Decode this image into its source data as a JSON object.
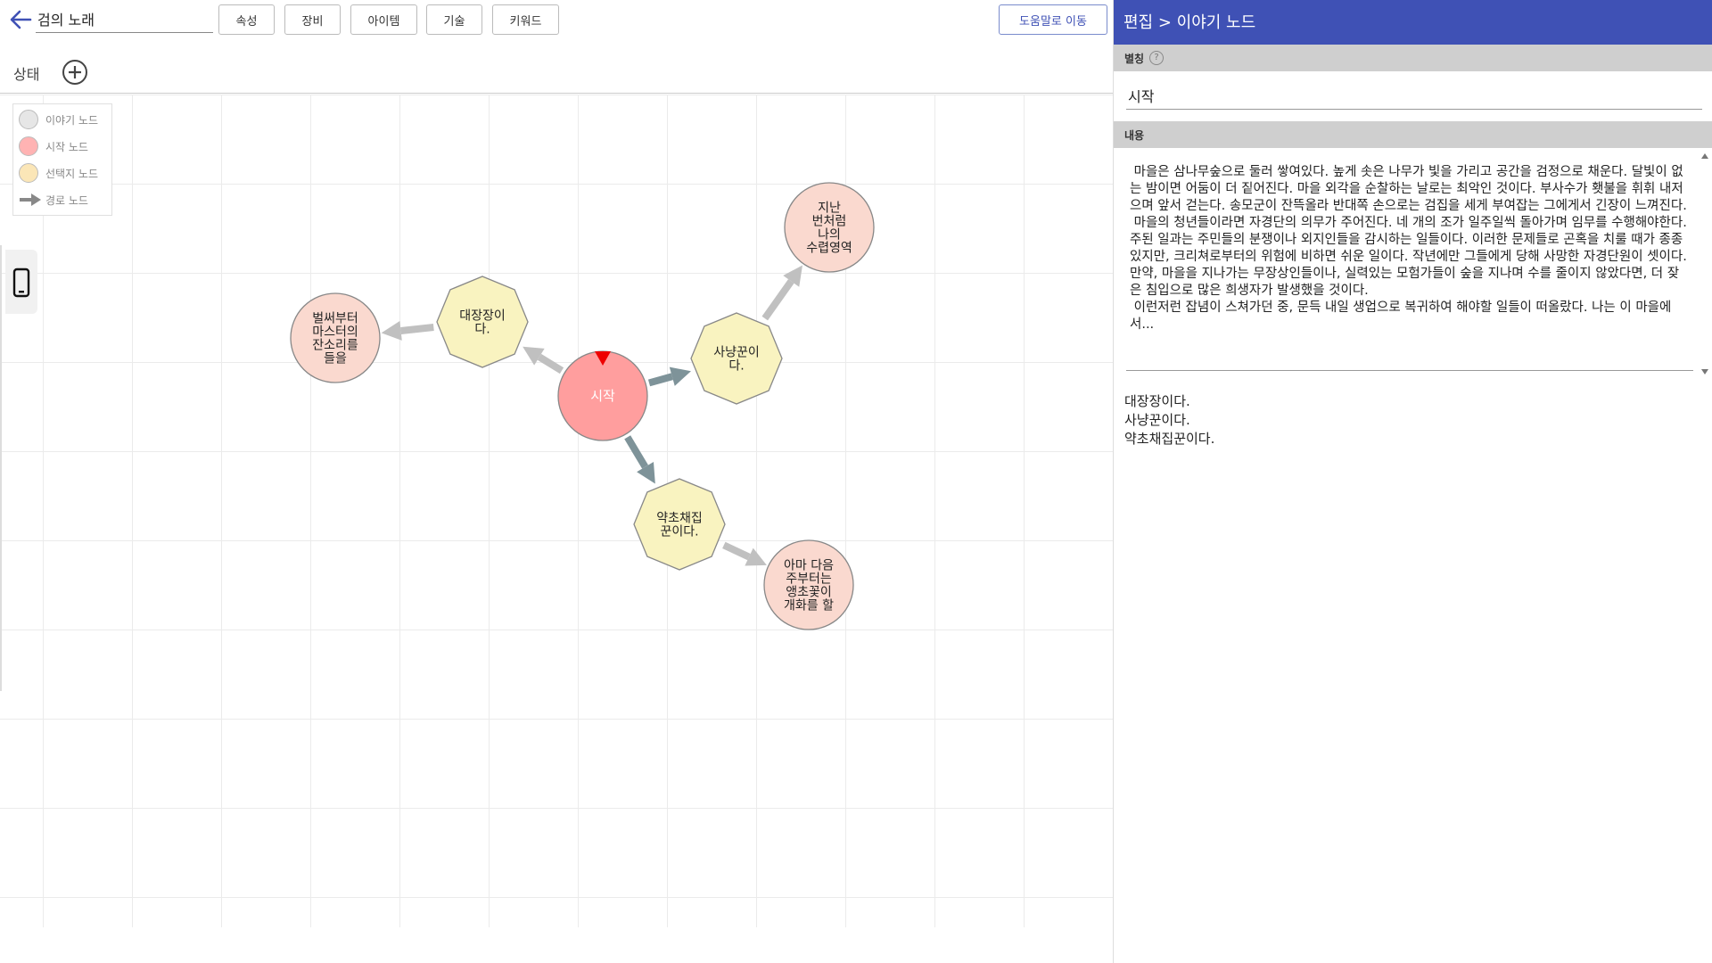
{
  "toolbar": {
    "title_value": "검의 노래",
    "buttons": [
      "속성",
      "장비",
      "아이템",
      "기술",
      "키워드"
    ],
    "help_label": "도움말로 이동"
  },
  "state": {
    "label": "상태"
  },
  "legend": {
    "items": [
      {
        "label": "이야기 노드",
        "color": "#e6e6e6"
      },
      {
        "label": "시작 노드",
        "color": "#ffb3b3"
      },
      {
        "label": "선택지 노드",
        "color": "#fbe6b7"
      },
      {
        "label": "경로 노드",
        "color": "#888888"
      }
    ]
  },
  "graph": {
    "nodes": [
      {
        "id": "start",
        "type": "start",
        "label": "시작"
      },
      {
        "id": "c1",
        "type": "choice",
        "label": "대장장이\n다."
      },
      {
        "id": "c2",
        "type": "choice",
        "label": "사냥꾼이\n다."
      },
      {
        "id": "c3",
        "type": "choice",
        "label": "약초채집\n꾼이다."
      },
      {
        "id": "s1",
        "type": "story",
        "label": "벌써부터\n마스터의\n잔소리를\n들을"
      },
      {
        "id": "s2",
        "type": "story",
        "label": "지난\n번처럼\n나의\n수렵영역"
      },
      {
        "id": "s3",
        "type": "story",
        "label": "아마 다음\n주부터는\n앵초꽃이\n개화를 할"
      }
    ],
    "edges": [
      {
        "from": "start",
        "to": "c1",
        "kind": "light"
      },
      {
        "from": "start",
        "to": "c2",
        "kind": "dark"
      },
      {
        "from": "start",
        "to": "c3",
        "kind": "dark"
      },
      {
        "from": "c1",
        "to": "s1",
        "kind": "light"
      },
      {
        "from": "c2",
        "to": "s2",
        "kind": "light"
      },
      {
        "from": "c3",
        "to": "s3",
        "kind": "light"
      }
    ],
    "colors": {
      "start_fill": "#ff9e9e",
      "choice_fill": "#f9f3c0",
      "story_fill": "#fad9cf",
      "edge_light": "#c0c0c0",
      "edge_dark": "#7e9399",
      "start_marker": "#ee0000"
    }
  },
  "panel": {
    "title": "편집 > 이야기 노드",
    "alias_label": "별칭",
    "alias_value": "시작",
    "content_label": "내용",
    "content_text": " 마을은 삼나무숲으로 둘러 쌓여있다. 높게 솟은 나무가 빛을 가리고 공간을 검정으로 채운다. 달빛이 없는 밤이면 어둠이 더 짙어진다. 마을 외각을 순찰하는 날로는 최악인 것이다. 부사수가 횃불을 휘휘 내저으며 앞서 걷는다. 송모군이 잔뜩올라 반대쪽 손으로는 검집을 세게 부여잡는 그에게서 긴장이 느껴진다.\n 마을의 청년들이라면 자경단의 의무가 주어진다. 네 개의 조가 일주일씩 돌아가며 임무를 수행해야한다. 주된 일과는 주민들의 분쟁이나 외지인들을 감시하는 일들이다. 이러한 문제들로 곤혹을 치룰 때가 종종 있지만, 크리쳐로부터의 위험에 비하면 쉬운 일이다. 작년에만 그들에게 당해 사망한 자경단원이 셋이다. 만약, 마을을 지나가는 무장상인들이나, 실력있는 모험가들이 숲을 지나며 수를 줄이지 않았다면, 더 잦은 침입으로 많은 희생자가 발생했을 것이다.\n 이런저런 잡념이 스쳐가던 중, 문득 내일 생업으로 복귀하여 해야할 일들이 떠올랐다. 나는 이 마을에서...",
    "choices": [
      "대장장이다.",
      "사냥꾼이다.",
      "약초채집꾼이다."
    ]
  }
}
